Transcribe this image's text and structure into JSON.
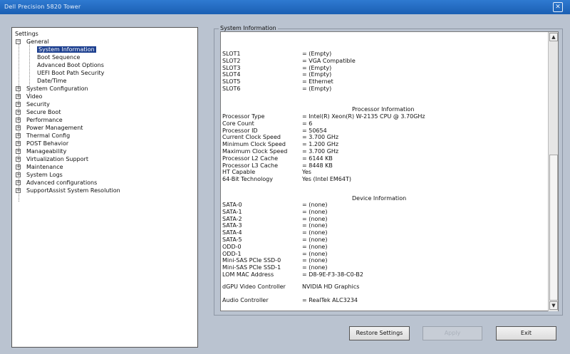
{
  "window": {
    "title": "Dell Precision 5820 Tower",
    "close_glyph": "✕"
  },
  "tree": {
    "root": "Settings",
    "items": [
      {
        "label": "General",
        "level": 1,
        "expander": "−"
      },
      {
        "label": "System Information",
        "level": 2,
        "selected": true
      },
      {
        "label": "Boot Sequence",
        "level": 2
      },
      {
        "label": "Advanced Boot Options",
        "level": 2
      },
      {
        "label": "UEFI Boot Path Security",
        "level": 2
      },
      {
        "label": "Date/Time",
        "level": 2
      },
      {
        "label": "System Configuration",
        "level": 1,
        "expander": "+"
      },
      {
        "label": "Video",
        "level": 1,
        "expander": "+"
      },
      {
        "label": "Security",
        "level": 1,
        "expander": "+"
      },
      {
        "label": "Secure Boot",
        "level": 1,
        "expander": "+"
      },
      {
        "label": "Performance",
        "level": 1,
        "expander": "+"
      },
      {
        "label": "Power Management",
        "level": 1,
        "expander": "+"
      },
      {
        "label": "Thermal Config",
        "level": 1,
        "expander": "+"
      },
      {
        "label": "POST Behavior",
        "level": 1,
        "expander": "+"
      },
      {
        "label": "Manageability",
        "level": 1,
        "expander": "+"
      },
      {
        "label": "Virtualization Support",
        "level": 1,
        "expander": "+"
      },
      {
        "label": "Maintenance",
        "level": 1,
        "expander": "+"
      },
      {
        "label": "System Logs",
        "level": 1,
        "expander": "+"
      },
      {
        "label": "Advanced configurations",
        "level": 1,
        "expander": "+"
      },
      {
        "label": "SupportAssist System Resolution",
        "level": 1,
        "expander": "+"
      }
    ]
  },
  "info": {
    "group_title": "System Information",
    "slots": [
      {
        "k": "SLOT1",
        "v": "= (Empty)"
      },
      {
        "k": "SLOT2",
        "v": "= VGA Compatible"
      },
      {
        "k": "SLOT3",
        "v": "= (Empty)"
      },
      {
        "k": "SLOT4",
        "v": "= (Empty)"
      },
      {
        "k": "SLOT5",
        "v": "= Ethernet"
      },
      {
        "k": "SLOT6",
        "v": "= (Empty)"
      }
    ],
    "processor_heading": "Processor Information",
    "processor": [
      {
        "k": "Processor Type",
        "v": "= Intel(R) Xeon(R) W-2135 CPU @ 3.70GHz"
      },
      {
        "k": "Core Count",
        "v": "= 6"
      },
      {
        "k": "Processor ID",
        "v": "= 50654"
      },
      {
        "k": "Current Clock Speed",
        "v": "= 3.700 GHz"
      },
      {
        "k": "Minimum Clock Speed",
        "v": "= 1.200 GHz"
      },
      {
        "k": "Maximum Clock Speed",
        "v": "= 3.700 GHz"
      },
      {
        "k": "Processor L2 Cache",
        "v": "= 6144 KB"
      },
      {
        "k": "Processor L3 Cache",
        "v": "= 8448 KB"
      },
      {
        "k": "HT Capable",
        "v": "Yes"
      },
      {
        "k": "64-Bit Technology",
        "v": "Yes (Intel EM64T)"
      }
    ],
    "device_heading": "Device Information",
    "devices": [
      {
        "k": "SATA-0",
        "v": "= (none)"
      },
      {
        "k": "SATA-1",
        "v": "= (none)"
      },
      {
        "k": "SATA-2",
        "v": "= (none)"
      },
      {
        "k": "SATA-3",
        "v": "= (none)"
      },
      {
        "k": "SATA-4",
        "v": "= (none)"
      },
      {
        "k": "SATA-5",
        "v": "= (none)"
      },
      {
        "k": "ODD-0",
        "v": "= (none)"
      },
      {
        "k": "ODD-1",
        "v": "= (none)"
      },
      {
        "k": "Mini-SAS PCIe SSD-0",
        "v": "= (none)"
      },
      {
        "k": "Mini-SAS PCIe SSD-1",
        "v": "= (none)"
      },
      {
        "k": "LOM MAC Address",
        "v": "= D8-9E-F3-38-C0-B2"
      }
    ],
    "dgpu": {
      "k": "dGPU Video Controller",
      "v": "NVIDIA HD Graphics"
    },
    "audio": {
      "k": "Audio Controller",
      "v": "= RealTek ALC3234"
    }
  },
  "scrollbar": {
    "up_glyph": "▲",
    "down_glyph": "▼"
  },
  "buttons": {
    "restore": "Restore Settings",
    "apply": "Apply",
    "exit": "Exit"
  },
  "colors": {
    "titlebar": "#1b5fb3",
    "selection": "#1c3f8f",
    "background": "#bac3d0"
  }
}
